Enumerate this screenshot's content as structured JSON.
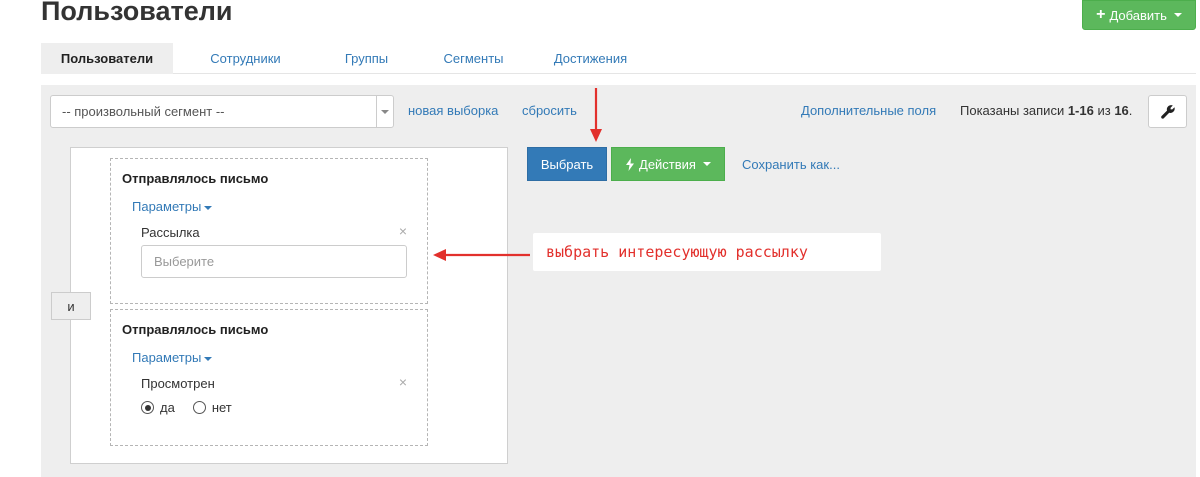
{
  "page": {
    "title": "Пользователи",
    "add_button_label": "Добавить"
  },
  "tabs": [
    {
      "label": "Пользователи",
      "active": true
    },
    {
      "label": "Сотрудники",
      "active": false
    },
    {
      "label": "Группы",
      "active": false
    },
    {
      "label": "Сегменты",
      "active": false
    },
    {
      "label": "Достижения",
      "active": false
    }
  ],
  "toolbar": {
    "segment_select_value": "-- произвольный сегмент --",
    "new_selection_label": "новая выборка",
    "reset_label": "сбросить",
    "extra_fields_label": "Дополнительные поля",
    "records_prefix": "Показаны записи ",
    "records_range": "1-16",
    "records_middle": " из ",
    "records_total": "16",
    "records_suffix": "."
  },
  "conditions": {
    "and_label": "и",
    "blocks": [
      {
        "title": "Отправлялось письмо",
        "params_label": "Параметры",
        "field_label": "Рассылка",
        "input_placeholder": "Выберите"
      },
      {
        "title": "Отправлялось письмо",
        "params_label": "Параметры",
        "field_label": "Просмотрен",
        "options": [
          {
            "label": "да",
            "checked": true
          },
          {
            "label": "нет",
            "checked": false
          }
        ]
      }
    ]
  },
  "actions": {
    "select_label": "Выбрать",
    "actions_label": "Действия",
    "save_as_label": "Сохранить как..."
  },
  "annotation": {
    "text": "выбрать интересующую рассылку"
  },
  "colors": {
    "primary": "#337ab7",
    "success": "#5cb85c",
    "annotation": "#e2302c",
    "panel_bg": "#eeeeee"
  }
}
